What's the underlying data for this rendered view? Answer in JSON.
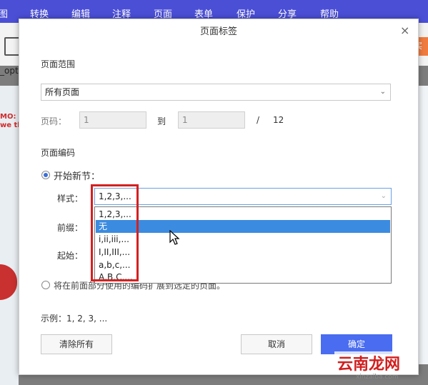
{
  "app": {
    "menu": [
      "图",
      "转换",
      "编辑",
      "注释",
      "页面",
      "表单",
      "保护",
      "分享",
      "帮助"
    ],
    "active_menu_index": 4,
    "side_tab": "_opt",
    "buy_button": "买",
    "bg_red_text": [
      "MO: P",
      "we th"
    ]
  },
  "dialog": {
    "title": "页面标签",
    "close_glyph": "×",
    "page_range": {
      "label": "页面范围",
      "select_value": "所有页面",
      "page_label": "页码：",
      "from": "1",
      "to_label": "到",
      "to": "1",
      "slash": "/",
      "total": "12"
    },
    "numbering": {
      "label": "页面编码",
      "new_section_label": "开始新节：",
      "style_label": "样式：",
      "style_value": "1,2,3,...",
      "prefix_label": "前缀：",
      "start_label": "起始：",
      "style_options": [
        "1,2,3,...",
        "无",
        "i,ii,iii,...",
        "I,II,III,...",
        "a,b,c,...",
        "A,B,C,..."
      ],
      "highlighted_option_index": 1,
      "extend_label": "将在前面部分使用的编码扩展到选定的页面。"
    },
    "example": "示例：1, 2, 3, ...",
    "buttons": {
      "clear": "清除所有",
      "cancel": "取消",
      "ok": "确定"
    }
  },
  "watermark": {
    "text": "云南龙网",
    "sub": "xinzaiba.com"
  },
  "colors": {
    "menubar": "#4b4fd6",
    "primary": "#4a6cf0",
    "highlight": "#3b8be0",
    "annotation_red": "#d42020"
  }
}
